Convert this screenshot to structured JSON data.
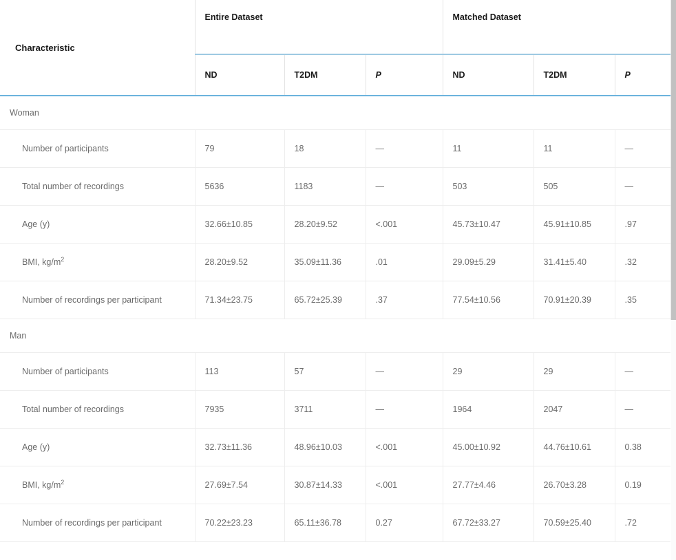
{
  "table": {
    "characteristic_header": "Characteristic",
    "groups": [
      {
        "label": "Entire Dataset",
        "columns": [
          "ND",
          "T2DM",
          "P"
        ]
      },
      {
        "label": "Matched Dataset",
        "columns": [
          "ND",
          "T2DM",
          "P"
        ]
      }
    ],
    "column_headers": [
      "Characteristic",
      "ND",
      "T2DM",
      "P",
      "ND",
      "T2DM",
      "P"
    ],
    "p_is_italic": true,
    "dash": "—",
    "sections": [
      {
        "name": "Woman",
        "rows": [
          {
            "label": "Number of participants",
            "label_sup": "",
            "values": [
              "79",
              "18",
              "—",
              "11",
              "11",
              "—"
            ]
          },
          {
            "label": "Total number of recordings",
            "label_sup": "",
            "values": [
              "5636",
              "1183",
              "—",
              "503",
              "505",
              "—"
            ]
          },
          {
            "label": "Age (y)",
            "label_sup": "",
            "values": [
              "32.66±10.85",
              "28.20±9.52",
              "<.001",
              "45.73±10.47",
              "45.91±10.85",
              ".97"
            ]
          },
          {
            "label": "BMI, kg/m",
            "label_sup": "2",
            "values": [
              "28.20±9.52",
              "35.09±11.36",
              ".01",
              "29.09±5.29",
              "31.41±5.40",
              ".32"
            ]
          },
          {
            "label": "Number of recordings per participant",
            "label_sup": "",
            "values": [
              "71.34±23.75",
              "65.72±25.39",
              ".37",
              "77.54±10.56",
              "70.91±20.39",
              ".35"
            ]
          }
        ]
      },
      {
        "name": "Man",
        "rows": [
          {
            "label": "Number of participants",
            "label_sup": "",
            "values": [
              "113",
              "57",
              "—",
              "29",
              "29",
              "—"
            ]
          },
          {
            "label": "Total number of recordings",
            "label_sup": "",
            "values": [
              "7935",
              "3711",
              "—",
              "1964",
              "2047",
              "—"
            ]
          },
          {
            "label": "Age (y)",
            "label_sup": "",
            "values": [
              "32.73±11.36",
              "48.96±10.03",
              "<.001",
              "45.00±10.92",
              "44.76±10.61",
              "0.38"
            ]
          },
          {
            "label": "BMI, kg/m",
            "label_sup": "2",
            "values": [
              "27.69±7.54",
              "30.87±14.33",
              "<.001",
              "27.77±4.46",
              "26.70±3.28",
              "0.19"
            ]
          },
          {
            "label": "Number of recordings per participant",
            "label_sup": "",
            "values": [
              "70.22±23.23",
              "65.11±36.78",
              "0.27",
              "67.72±33.27",
              "70.59±25.40",
              ".72"
            ]
          }
        ]
      }
    ]
  },
  "colors": {
    "header_rule": "#6cb3dd",
    "group_rule": "#9ec9e2",
    "row_rule": "#ededed",
    "text": "#6b6b6b",
    "header_text": "#1a1a1a",
    "scrollbar_thumb": "#c1c1c1"
  }
}
